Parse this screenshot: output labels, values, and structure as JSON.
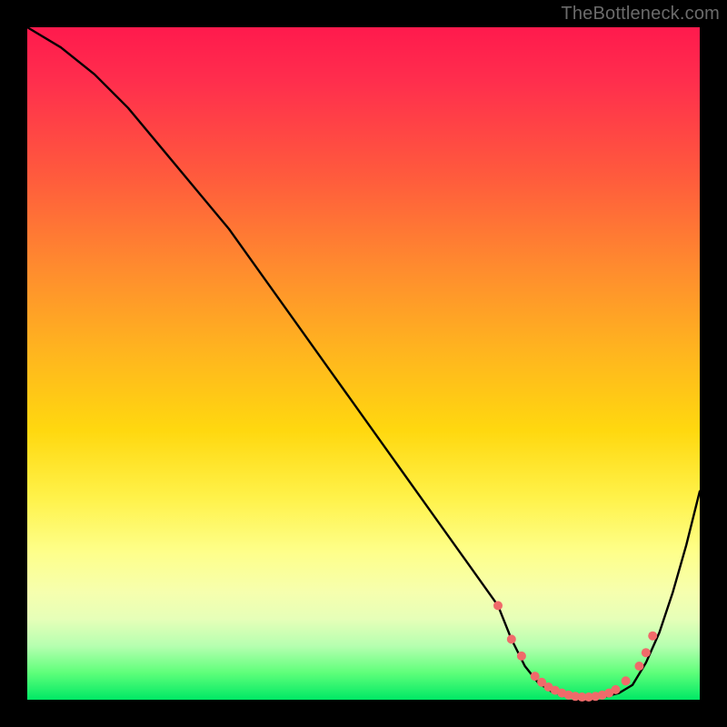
{
  "watermark": "TheBottleneck.com",
  "chart_data": {
    "type": "line",
    "title": "",
    "xlabel": "",
    "ylabel": "",
    "xlim": [
      0,
      100
    ],
    "ylim": [
      0,
      100
    ],
    "series": [
      {
        "name": "bottleneck-curve",
        "x": [
          0,
          5,
          10,
          15,
          20,
          25,
          30,
          35,
          40,
          45,
          50,
          55,
          60,
          65,
          70,
          72,
          74,
          76,
          78,
          80,
          82,
          84,
          86,
          88,
          90,
          92,
          94,
          96,
          98,
          100
        ],
        "y": [
          100,
          97,
          93,
          88,
          82,
          76,
          70,
          63,
          56,
          49,
          42,
          35,
          28,
          21,
          14,
          9,
          5,
          2.5,
          1.2,
          0.6,
          0.3,
          0.3,
          0.5,
          1.0,
          2.2,
          5.5,
          10,
          16,
          23,
          31
        ]
      }
    ],
    "markers": {
      "name": "highlight-dots",
      "color": "#f06a6a",
      "x": [
        70,
        72,
        73.5,
        75.5,
        76.5,
        77.5,
        78.5,
        79.5,
        80.5,
        81.5,
        82.5,
        83.5,
        84.5,
        85.5,
        86.5,
        87.5,
        89,
        91,
        92,
        93
      ],
      "y": [
        14,
        9,
        6.5,
        3.5,
        2.6,
        1.9,
        1.4,
        1.0,
        0.7,
        0.5,
        0.4,
        0.4,
        0.5,
        0.7,
        1.0,
        1.5,
        2.8,
        5.0,
        7.0,
        9.5
      ]
    },
    "gradient_stops": [
      {
        "pos": 0,
        "color": "#ff1a4d"
      },
      {
        "pos": 22,
        "color": "#ff5a3d"
      },
      {
        "pos": 48,
        "color": "#ffb41f"
      },
      {
        "pos": 70,
        "color": "#fff24a"
      },
      {
        "pos": 88,
        "color": "#e6ffb8"
      },
      {
        "pos": 100,
        "color": "#00e865"
      }
    ]
  }
}
